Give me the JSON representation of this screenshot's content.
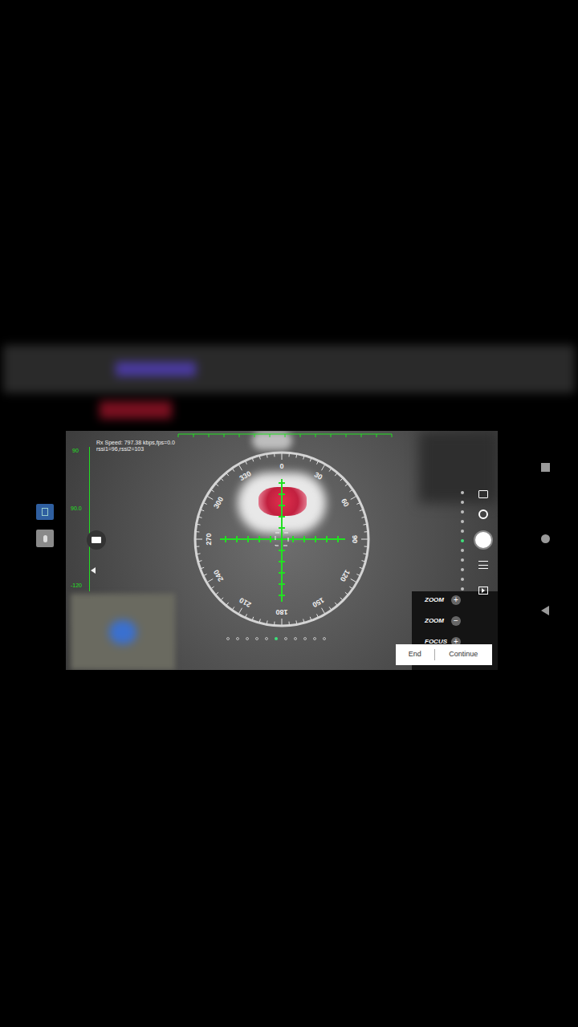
{
  "telemetry": {
    "rx_speed": "Rx Speed: 797.38 kbps,fps=0.0",
    "rssi": "rssi1=96,rssi2=103"
  },
  "pitch_scale": {
    "top": "90",
    "mid": "90.0",
    "bottom": "-120"
  },
  "compass": {
    "labels": [
      "0",
      "30",
      "60",
      "90",
      "120",
      "150",
      "180",
      "210",
      "240",
      "270",
      "300",
      "330"
    ]
  },
  "side_dots": [
    {
      "selected": false
    },
    {
      "selected": false
    },
    {
      "selected": false
    },
    {
      "selected": false
    },
    {
      "selected": false
    },
    {
      "selected": true
    },
    {
      "selected": false
    },
    {
      "selected": false
    },
    {
      "selected": false
    },
    {
      "selected": false
    },
    {
      "selected": false
    }
  ],
  "page_dots": [
    {
      "selected": false
    },
    {
      "selected": false
    },
    {
      "selected": false
    },
    {
      "selected": false
    },
    {
      "selected": false
    },
    {
      "selected": true
    },
    {
      "selected": false
    },
    {
      "selected": false
    },
    {
      "selected": false
    },
    {
      "selected": false
    },
    {
      "selected": false
    }
  ],
  "lens_controls": [
    {
      "label": "ZOOM",
      "symbol": "+"
    },
    {
      "label": "ZOOM",
      "symbol": "−"
    },
    {
      "label": "FOCUS",
      "symbol": "+"
    }
  ],
  "dialog": {
    "buttons": [
      "End",
      "Continue"
    ]
  }
}
